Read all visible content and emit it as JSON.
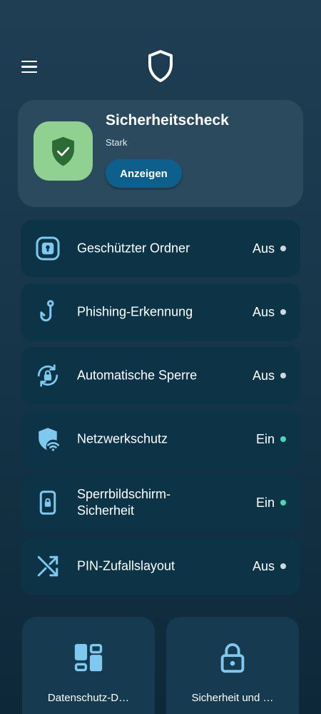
{
  "header": {
    "menu_icon": "menu-icon",
    "logo_icon": "shield-outline-icon"
  },
  "security_check": {
    "title": "Sicherheitscheck",
    "status": "Stark",
    "button_label": "Anzeigen",
    "icon": "shield-check-icon"
  },
  "features": [
    {
      "label": "Geschützter Ordner",
      "status": "Aus",
      "enabled": false,
      "icon": "secure-folder-icon"
    },
    {
      "label": "Phishing-Erkennung",
      "status": "Aus",
      "enabled": false,
      "icon": "fish-hook-icon"
    },
    {
      "label": "Automatische Sperre",
      "status": "Aus",
      "enabled": false,
      "icon": "auto-lock-icon"
    },
    {
      "label": "Netzwerkschutz",
      "status": "Ein",
      "enabled": true,
      "icon": "network-shield-icon"
    },
    {
      "label": "Sperrbildschirm-Sicherheit",
      "status": "Ein",
      "enabled": true,
      "icon": "lock-screen-icon"
    },
    {
      "label": "PIN-Zufallslayout",
      "status": "Aus",
      "enabled": false,
      "icon": "shuffle-icon"
    }
  ],
  "tiles": [
    {
      "label": "Datenschutz-D…",
      "icon": "dashboard-icon"
    },
    {
      "label": "Sicherheit und …",
      "icon": "lock-icon"
    }
  ],
  "colors": {
    "accent": "#7fc8f0",
    "status_on": "#4dd6b4",
    "status_off": "#cfd8dc",
    "button": "#0f5f8c",
    "badge": "#90d192"
  }
}
